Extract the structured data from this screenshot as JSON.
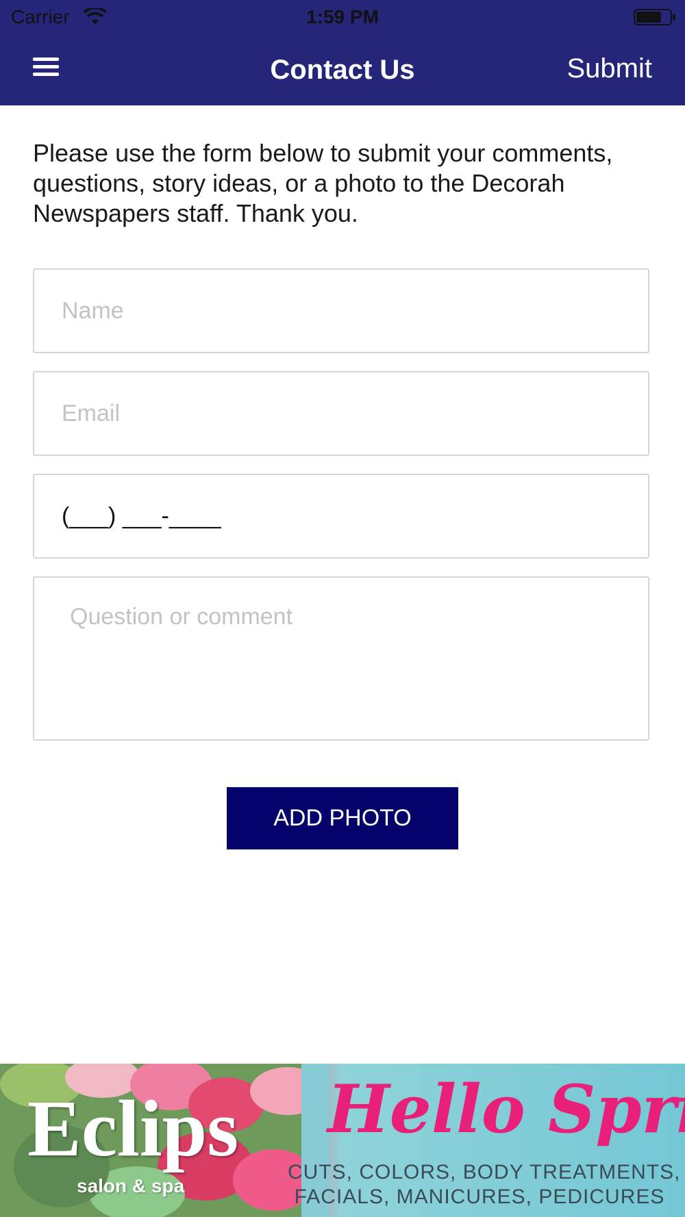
{
  "status_bar": {
    "carrier": "Carrier",
    "time": "1:59 PM",
    "wifi_icon": "wifi-icon",
    "battery_icon": "battery-icon"
  },
  "nav": {
    "title": "Contact Us",
    "submit_label": "Submit",
    "menu_icon": "hamburger-menu-icon",
    "bar_color": "#25267a"
  },
  "intro_text": "Please use the form below to submit your comments, questions, story ideas, or a photo to the Decorah Newspapers staff. Thank you.",
  "form": {
    "name": {
      "placeholder": "Name",
      "value": ""
    },
    "email": {
      "placeholder": "Email",
      "value": ""
    },
    "phone": {
      "value": "(___) ___-____"
    },
    "comment": {
      "placeholder": "Question or comment",
      "value": ""
    }
  },
  "add_photo_label": "ADD PHOTO",
  "ad_banner": {
    "brand": "Eclips",
    "brand_sub": "salon & spa",
    "headline": "Hello Spring",
    "line1": "CUTS, COLORS, BODY TREATMENTS,",
    "line2": "FACIALS, MANICURES, PEDICURES",
    "headline_color": "#e8207a"
  }
}
